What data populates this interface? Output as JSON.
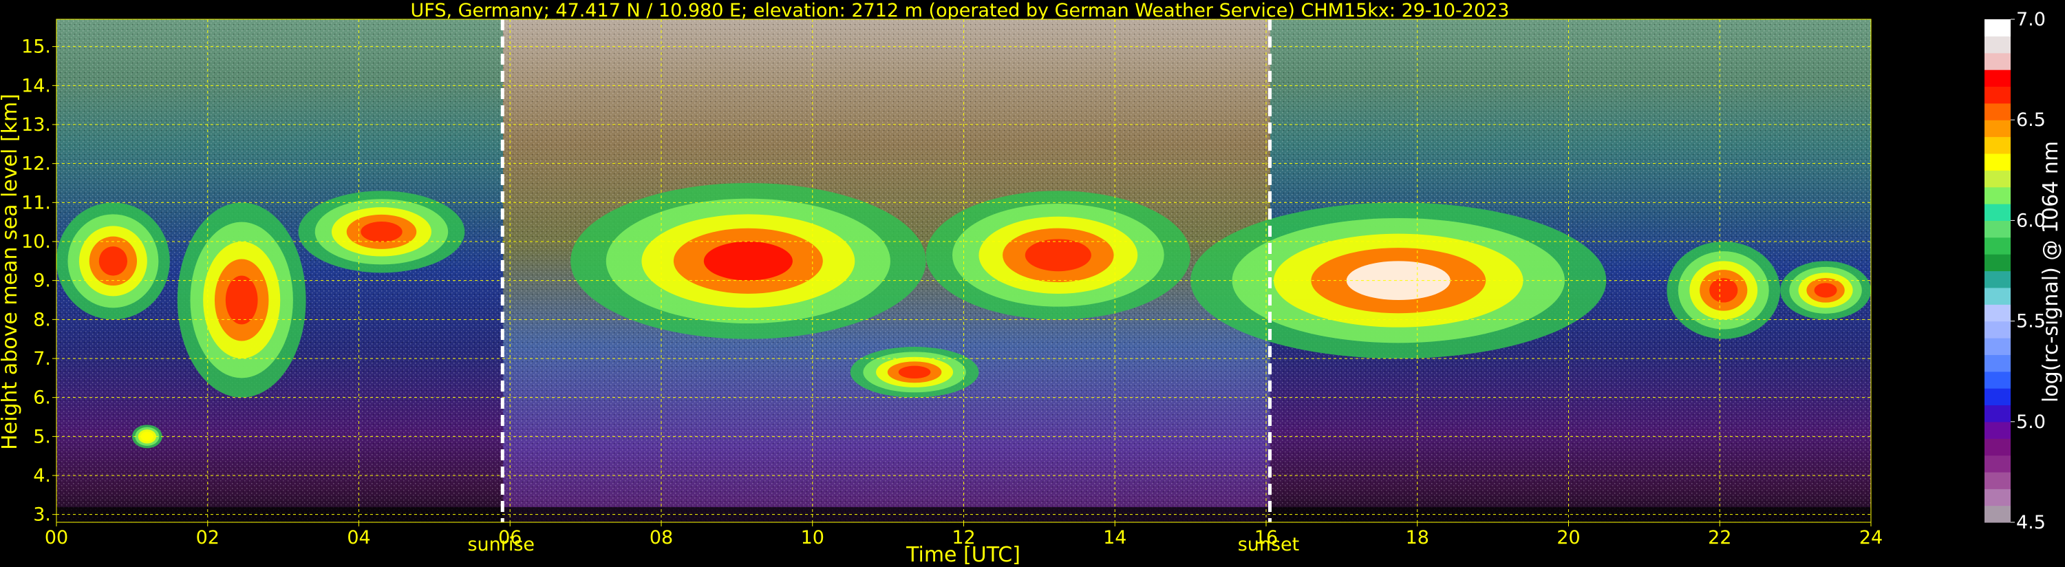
{
  "chart_data": {
    "type": "heatmap",
    "title": "UFS, Germany; 47.417 N / 10.980 E; elevation: 2712 m  (operated by German Weather Service)    CHM15kx: 29-10-2023",
    "xlabel": "Time [UTC]",
    "ylabel": "Height above mean sea level [km]",
    "xlim": [
      0,
      24
    ],
    "ylim": [
      2.8,
      15.7
    ],
    "x_ticks": [
      "00",
      "02",
      "04",
      "06",
      "08",
      "10",
      "12",
      "14",
      "16",
      "18",
      "20",
      "22",
      "24"
    ],
    "y_ticks": [
      "3.",
      "4.",
      "5.",
      "6.",
      "7.",
      "8.",
      "9.",
      "10.",
      "11.",
      "12.",
      "13.",
      "14.",
      "15."
    ],
    "grid": true,
    "grid_color": "#ffff00",
    "markers": [
      {
        "label": "sunrise",
        "x": 5.9
      },
      {
        "label": "sunset",
        "x": 16.05
      }
    ],
    "colorbar": {
      "label": "log(rc-signal) @ 1064 nm",
      "range": [
        4.5,
        7.0
      ],
      "ticks": [
        "4.5",
        "5.0",
        "5.5",
        "6.0",
        "6.5",
        "7.0"
      ],
      "colors": [
        "#a899a8",
        "#b07ab0",
        "#a0509a",
        "#8a2a8a",
        "#7a1280",
        "#6a0aa0",
        "#3a10c8",
        "#1a30ee",
        "#2f60ff",
        "#5a86ff",
        "#7f9fff",
        "#9fb3ff",
        "#b7c6ff",
        "#6fd0d8",
        "#2aa89a",
        "#1a9a3a",
        "#30c050",
        "#60dd70",
        "#2ae0a0",
        "#80f060",
        "#c8f040",
        "#ffff00",
        "#ffcc00",
        "#ff9900",
        "#ff6600",
        "#ff2200",
        "#ff0000",
        "#f0c0c0",
        "#e8e0e0",
        "#ffffff"
      ]
    },
    "cloud_layers": [
      {
        "t_start": 0.0,
        "t_end": 1.5,
        "z_bottom": 8.0,
        "z_top": 11.0,
        "max_signal": 6.6
      },
      {
        "t_start": 1.6,
        "t_end": 3.3,
        "z_bottom": 6.0,
        "z_top": 11.0,
        "max_signal": 6.6
      },
      {
        "t_start": 3.2,
        "t_end": 5.4,
        "z_bottom": 9.2,
        "z_top": 11.3,
        "max_signal": 6.6
      },
      {
        "t_start": 1.0,
        "t_end": 1.4,
        "z_bottom": 4.7,
        "z_top": 5.3,
        "max_signal": 6.3
      },
      {
        "t_start": 6.8,
        "t_end": 11.5,
        "z_bottom": 7.5,
        "z_top": 11.5,
        "max_signal": 6.7
      },
      {
        "t_start": 10.5,
        "t_end": 12.2,
        "z_bottom": 6.0,
        "z_top": 7.3,
        "max_signal": 6.6
      },
      {
        "t_start": 11.5,
        "t_end": 15.0,
        "z_bottom": 8.0,
        "z_top": 11.3,
        "max_signal": 6.6
      },
      {
        "t_start": 15.0,
        "t_end": 20.5,
        "z_bottom": 7.0,
        "z_top": 11.0,
        "max_signal": 7.0
      },
      {
        "t_start": 21.3,
        "t_end": 22.8,
        "z_bottom": 7.5,
        "z_top": 10.0,
        "max_signal": 6.6
      },
      {
        "t_start": 22.8,
        "t_end": 24.0,
        "z_bottom": 8.0,
        "z_top": 9.5,
        "max_signal": 6.6
      }
    ]
  }
}
